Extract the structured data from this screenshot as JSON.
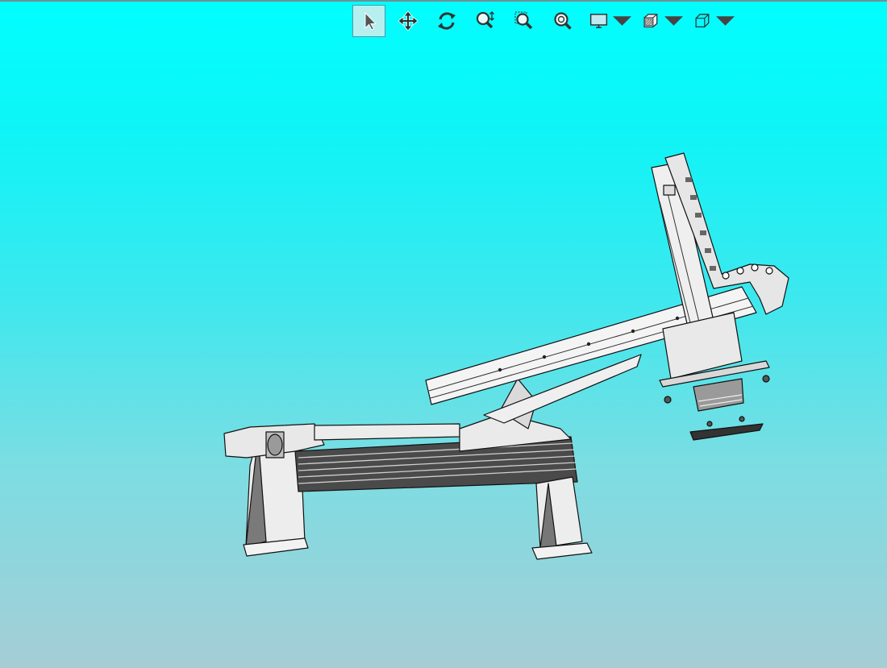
{
  "toolbar": {
    "buttons": [
      {
        "id": "select",
        "icon": "select-arrow-icon",
        "active": true
      },
      {
        "id": "pan",
        "icon": "pan-move-icon",
        "active": false
      },
      {
        "id": "rotate",
        "icon": "rotate-icon",
        "active": false
      },
      {
        "id": "zoom-in-out",
        "icon": "zoom-in-out-icon",
        "active": false
      },
      {
        "id": "zoom-window",
        "icon": "zoom-window-icon",
        "active": false
      },
      {
        "id": "zoom-fit",
        "icon": "zoom-fit-icon",
        "active": false
      },
      {
        "id": "display-style",
        "icon": "monitor-icon",
        "dropdown": true
      },
      {
        "id": "section-view",
        "icon": "section-view-icon",
        "dropdown": true
      },
      {
        "id": "view-orientation",
        "icon": "cube-view-icon",
        "dropdown": true
      }
    ]
  },
  "colors": {
    "background_top": "#00ffff",
    "background_bottom": "#a6cdd6",
    "model_face": "#ededed",
    "model_edge": "#111111",
    "toolbar_active": "#b6eff0"
  }
}
